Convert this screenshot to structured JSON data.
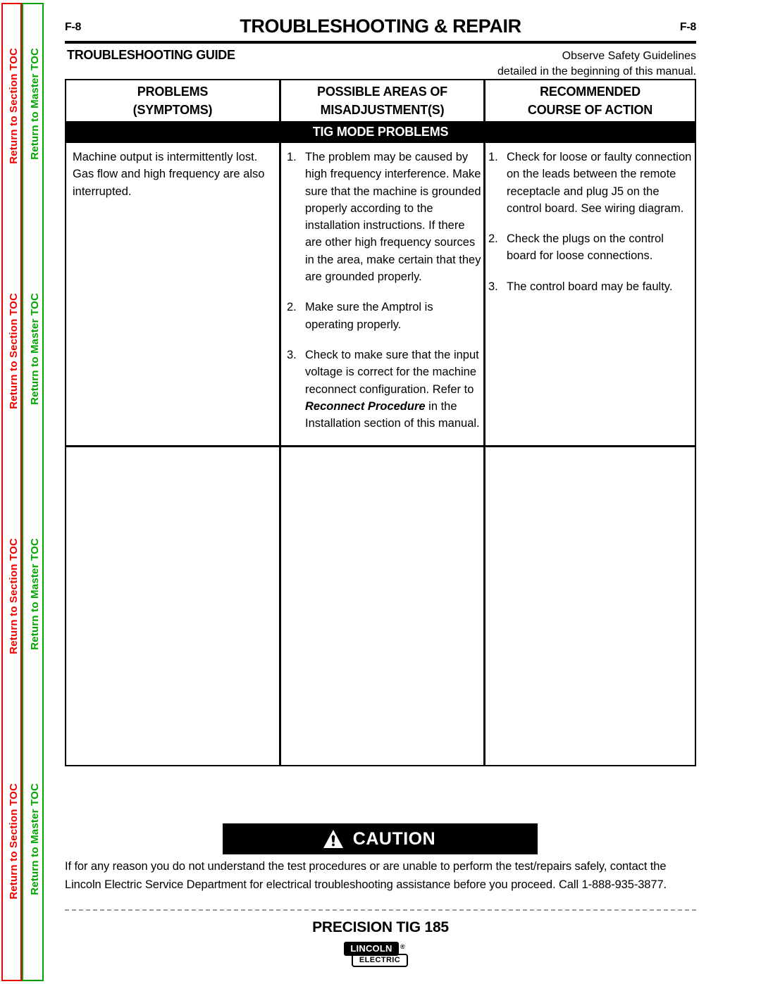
{
  "sidebar": {
    "section_toc_label": "Return to Section TOC",
    "master_toc_label": "Return to Master TOC",
    "section_toc_color": "#ee0000",
    "master_toc_color": "#00a400",
    "repeat_count": 4
  },
  "header": {
    "folio_left": "F-8",
    "folio_right": "F-8",
    "title": "TROUBLESHOOTING & REPAIR"
  },
  "guide": {
    "title": "TROUBLESHOOTING GUIDE",
    "safety_note_line1": "Observe Safety Guidelines",
    "safety_note_line2": "detailed in the beginning of this manual."
  },
  "table": {
    "headers": [
      {
        "line1": "PROBLEMS",
        "line2": "(SYMPTOMS)"
      },
      {
        "line1": "POSSIBLE AREAS OF",
        "line2": "MISADJUSTMENT(S)"
      },
      {
        "line1": "RECOMMENDED",
        "line2": "COURSE OF ACTION"
      }
    ],
    "section_banner": "TIG MODE PROBLEMS",
    "rows": [
      {
        "symptom": "Machine output is intermittently lost. Gas flow and high frequency are also interrupted.",
        "misadjustments": [
          {
            "num": "1.",
            "text_before": "The problem may be caused by high frequency interference. Make sure that the machine is grounded  properly according to the installation instructions.   If there are other high frequency sources in the area, make certain that they are grounded properly.",
            "emphasis": "",
            "text_after": ""
          },
          {
            "num": "2.",
            "text_before": "Make sure the Amptrol is operating properly.",
            "emphasis": "",
            "text_after": ""
          },
          {
            "num": "3.",
            "text_before": "Check to make sure that the input voltage is correct for the machine reconnect configuration. Refer to ",
            "emphasis": "Reconnect Procedure",
            "text_after": " in the Installation section of this manual."
          }
        ],
        "actions": [
          {
            "num": "1.",
            "text": "Check for loose or faulty connection on the leads between the remote receptacle and plug J5 on the control board.  See wiring diagram."
          },
          {
            "num": "2.",
            "text": "Check the plugs on the control board for loose connections."
          },
          {
            "num": "3.",
            "text": "The control board may be faulty."
          }
        ]
      },
      {
        "symptom": "",
        "misadjustments": [],
        "actions": []
      }
    ]
  },
  "caution": {
    "icon_name": "warning-triangle-icon",
    "word": "CAUTION",
    "body": "If for any reason you do not understand the test procedures or are unable to perform the test/repairs safely, contact the Lincoln Electric Service Department for electrical troubleshooting assistance before you proceed.  Call 1-888-935-3877."
  },
  "footer": {
    "model": "PRECISION TIG 185",
    "logo_lincoln": "LINCOLN",
    "logo_electric": "ELECTRIC",
    "logo_registered": "®"
  }
}
